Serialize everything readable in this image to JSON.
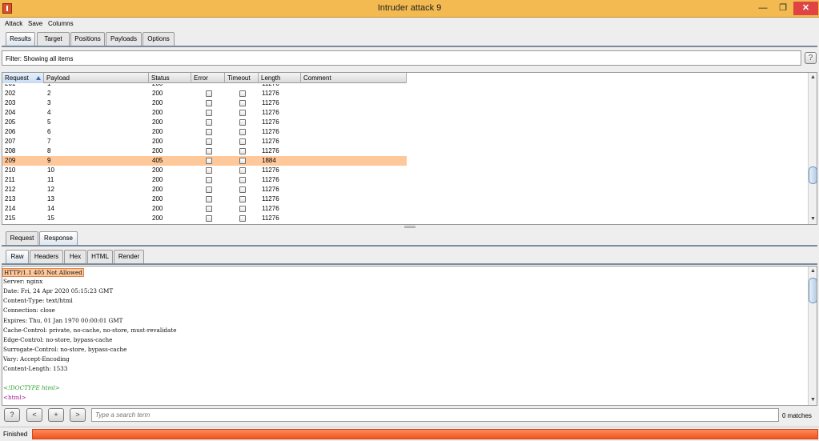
{
  "window": {
    "title": "Intruder attack 9",
    "controls": {
      "minimize": "—",
      "maximize": "❐",
      "close": "✕"
    }
  },
  "menu": [
    "Attack",
    "Save",
    "Columns"
  ],
  "main_tabs": [
    "Results",
    "Target",
    "Positions",
    "Payloads",
    "Options"
  ],
  "active_main_tab": "Results",
  "filter": {
    "text": "Filter: Showing all items",
    "help": "?"
  },
  "table": {
    "columns": [
      "Request",
      "Payload",
      "Status",
      "Error",
      "Timeout",
      "Length",
      "Comment"
    ],
    "sorted_column": "Request",
    "partial_top_row": {
      "request": "201",
      "payload": "1",
      "status": "200",
      "length": "11276"
    },
    "rows": [
      {
        "request": "202",
        "payload": "2",
        "status": "200",
        "length": "11276"
      },
      {
        "request": "203",
        "payload": "3",
        "status": "200",
        "length": "11276"
      },
      {
        "request": "204",
        "payload": "4",
        "status": "200",
        "length": "11276"
      },
      {
        "request": "205",
        "payload": "5",
        "status": "200",
        "length": "11276"
      },
      {
        "request": "206",
        "payload": "6",
        "status": "200",
        "length": "11276"
      },
      {
        "request": "207",
        "payload": "7",
        "status": "200",
        "length": "11276"
      },
      {
        "request": "208",
        "payload": "8",
        "status": "200",
        "length": "11276"
      },
      {
        "request": "209",
        "payload": "9",
        "status": "405",
        "length": "1884",
        "highlighted": true
      },
      {
        "request": "210",
        "payload": "10",
        "status": "200",
        "length": "11276"
      },
      {
        "request": "211",
        "payload": "11",
        "status": "200",
        "length": "11276"
      },
      {
        "request": "212",
        "payload": "12",
        "status": "200",
        "length": "11276"
      },
      {
        "request": "213",
        "payload": "13",
        "status": "200",
        "length": "11276"
      },
      {
        "request": "214",
        "payload": "14",
        "status": "200",
        "length": "11276"
      },
      {
        "request": "215",
        "payload": "15",
        "status": "200",
        "length": "11276"
      }
    ],
    "highlight_color": "#ffc89a"
  },
  "message_tabs": [
    "Request",
    "Response"
  ],
  "active_message_tab": "Response",
  "view_tabs": [
    "Raw",
    "Headers",
    "Hex",
    "HTML",
    "Render"
  ],
  "active_view_tab": "Raw",
  "response": {
    "status_line": "HTTP/1.1 405 Not Allowed",
    "headers": [
      "Server: nginx",
      "Date: Fri, 24 Apr 2020 05:15:23 GMT",
      "Content-Type: text/html",
      "Connection: close",
      "Expires: Thu, 01 Jan 1970 00:00:01 GMT",
      "Cache-Control: private, no-cache, no-store, must-revalidate",
      "Edge-Control: no-store, bypass-cache",
      "Surrogate-Control: no-store, bypass-cache",
      "Vary: Accept-Encoding",
      "Content-Length: 1533"
    ],
    "body_lines": [
      "<!DOCTYPE html>",
      "<html>"
    ]
  },
  "search": {
    "help": "?",
    "prev": "<",
    "add": "+",
    "next": ">",
    "placeholder": "Type a search term",
    "matches": "0 matches"
  },
  "status": {
    "text": "Finished",
    "progress": 1.0,
    "progress_color": "#ff6d3c"
  }
}
